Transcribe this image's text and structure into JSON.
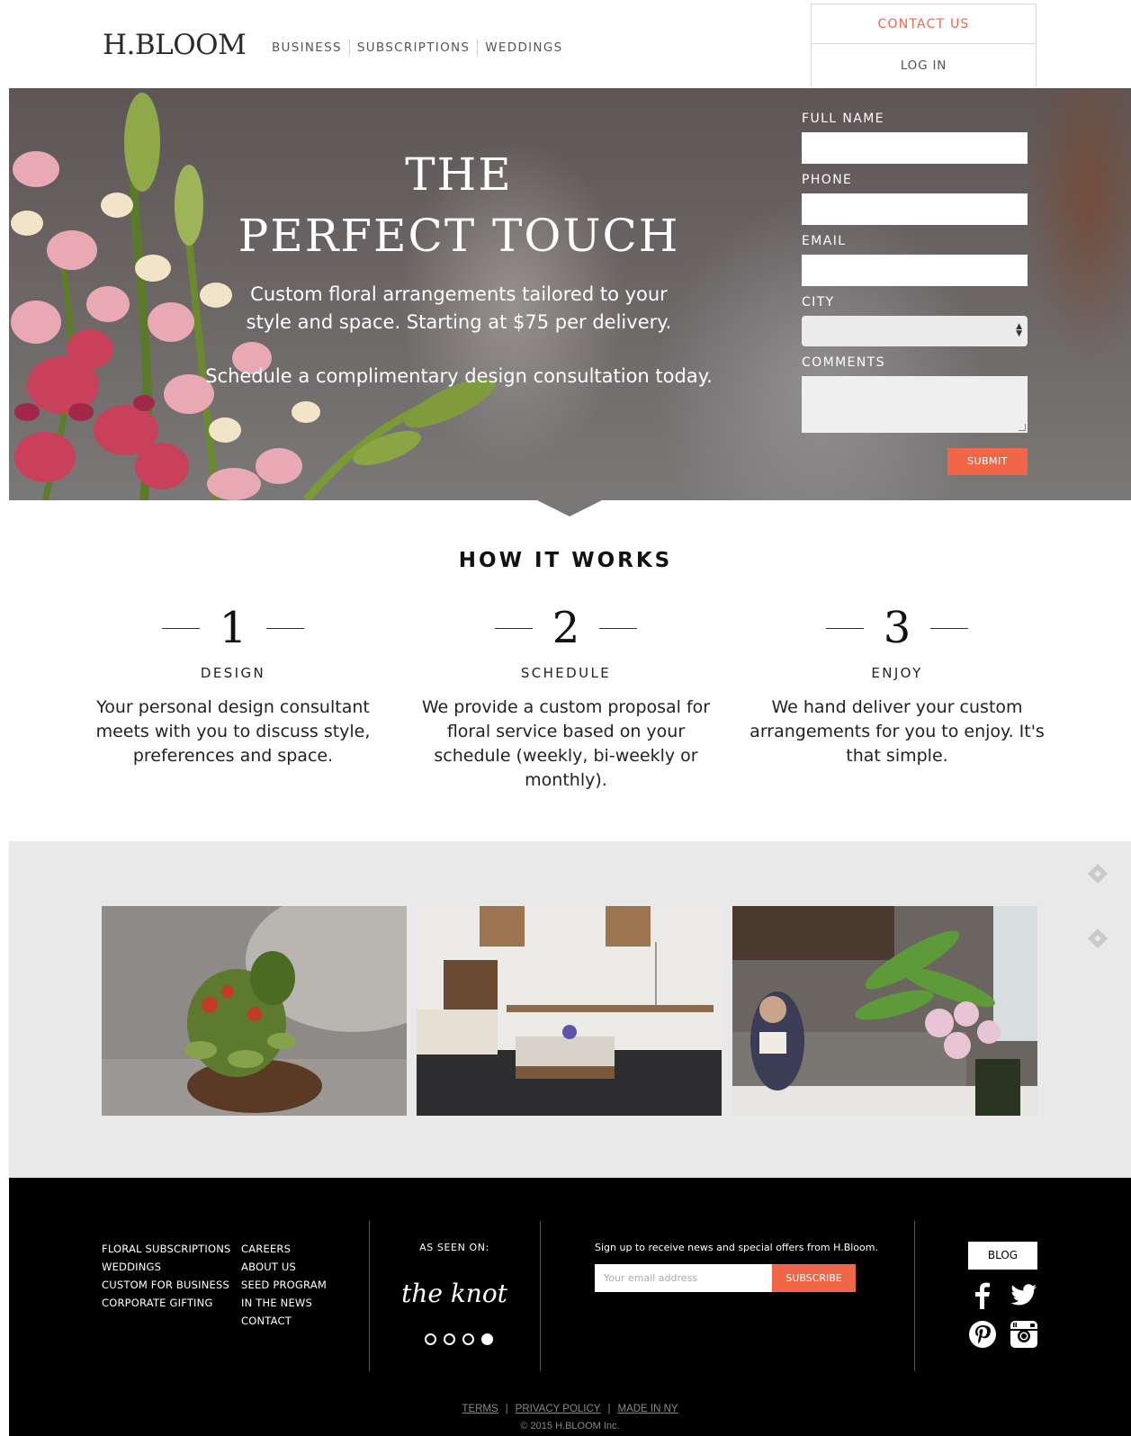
{
  "header": {
    "logo": "H.BLOOM",
    "nav": [
      "BUSINESS",
      "SUBSCRIPTIONS",
      "WEDDINGS"
    ],
    "contact_label": "CONTACT US",
    "login_label": "LOG IN"
  },
  "hero": {
    "title_line1": "THE",
    "title_line2": "PERFECT TOUCH",
    "subtitle_line1": "Custom floral arrangements tailored to your",
    "subtitle_line2": "style and space. Starting at $75 per delivery.",
    "cta": "Schedule a complimentary design consultation today."
  },
  "form": {
    "full_name_label": "FULL NAME",
    "phone_label": "PHONE",
    "email_label": "EMAIL",
    "city_label": "CITY",
    "comments_label": "COMMENTS",
    "submit_label": "SUBMIT"
  },
  "how_it_works": {
    "title": "HOW IT WORKS",
    "steps": [
      {
        "num": "1",
        "label": "DESIGN",
        "desc": "Your personal design consultant meets with you to discuss style, preferences and space."
      },
      {
        "num": "2",
        "label": "SCHEDULE",
        "desc": "We provide a custom proposal for floral service based on your schedule (weekly, bi-weekly or monthly)."
      },
      {
        "num": "3",
        "label": "ENJOY",
        "desc": "We hand deliver your custom arrangements for you to enjoy. It's that simple."
      }
    ]
  },
  "footer": {
    "col1": [
      "FLORAL SUBSCRIPTIONS",
      "WEDDINGS",
      "CUSTOM FOR BUSINESS",
      "CORPORATE GIFTING"
    ],
    "col2": [
      "CAREERS",
      "ABOUT US",
      "SEED PROGRAM",
      "IN THE NEWS",
      "CONTACT"
    ],
    "as_seen_on": "AS SEEN ON:",
    "press_logo": "the knot",
    "signup_text": "Sign up to receive news and special offers from H.Bloom.",
    "email_placeholder": "Your email address",
    "subscribe_label": "SUBSCRIBE",
    "blog_label": "BLOG",
    "legal_links": [
      "TERMS",
      "PRIVACY POLICY",
      "MADE IN NY"
    ],
    "legal_separator": "|",
    "copyright": "© 2015 H.BLOOM Inc."
  },
  "colors": {
    "accent": "#f26648",
    "footer_bg": "#000000",
    "gallery_bg": "#e9e9e9"
  },
  "icons": [
    "chevron-up-down-icon",
    "feedly-icon",
    "facebook-icon",
    "twitter-icon",
    "pinterest-icon",
    "instagram-icon"
  ],
  "carousel": {
    "active_index": 4,
    "count": 4
  }
}
